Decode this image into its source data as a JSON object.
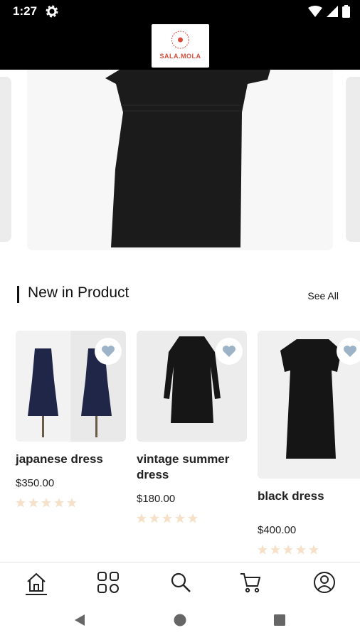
{
  "status_bar": {
    "time": "1:27"
  },
  "logo": {
    "text": "SALA.MOLA"
  },
  "section": {
    "title": "New in Product",
    "see_all": "See All"
  },
  "products": [
    {
      "name": "japanese dress",
      "price": "$350.00",
      "rating": 0
    },
    {
      "name": "vintage summer dress",
      "price": "$180.00",
      "rating": 0
    },
    {
      "name": "black dress",
      "price": "$400.00",
      "rating": 0
    }
  ],
  "colors": {
    "accent": "#000000",
    "logo_red": "#d94b3a",
    "heart": "#9db3c7",
    "star_empty": "#f6e1c8"
  },
  "icons": {
    "bottom_nav": [
      "home-icon",
      "categories-icon",
      "search-icon",
      "cart-icon",
      "account-icon"
    ],
    "system_nav": [
      "back-icon",
      "home-circle-icon",
      "recents-icon"
    ]
  }
}
